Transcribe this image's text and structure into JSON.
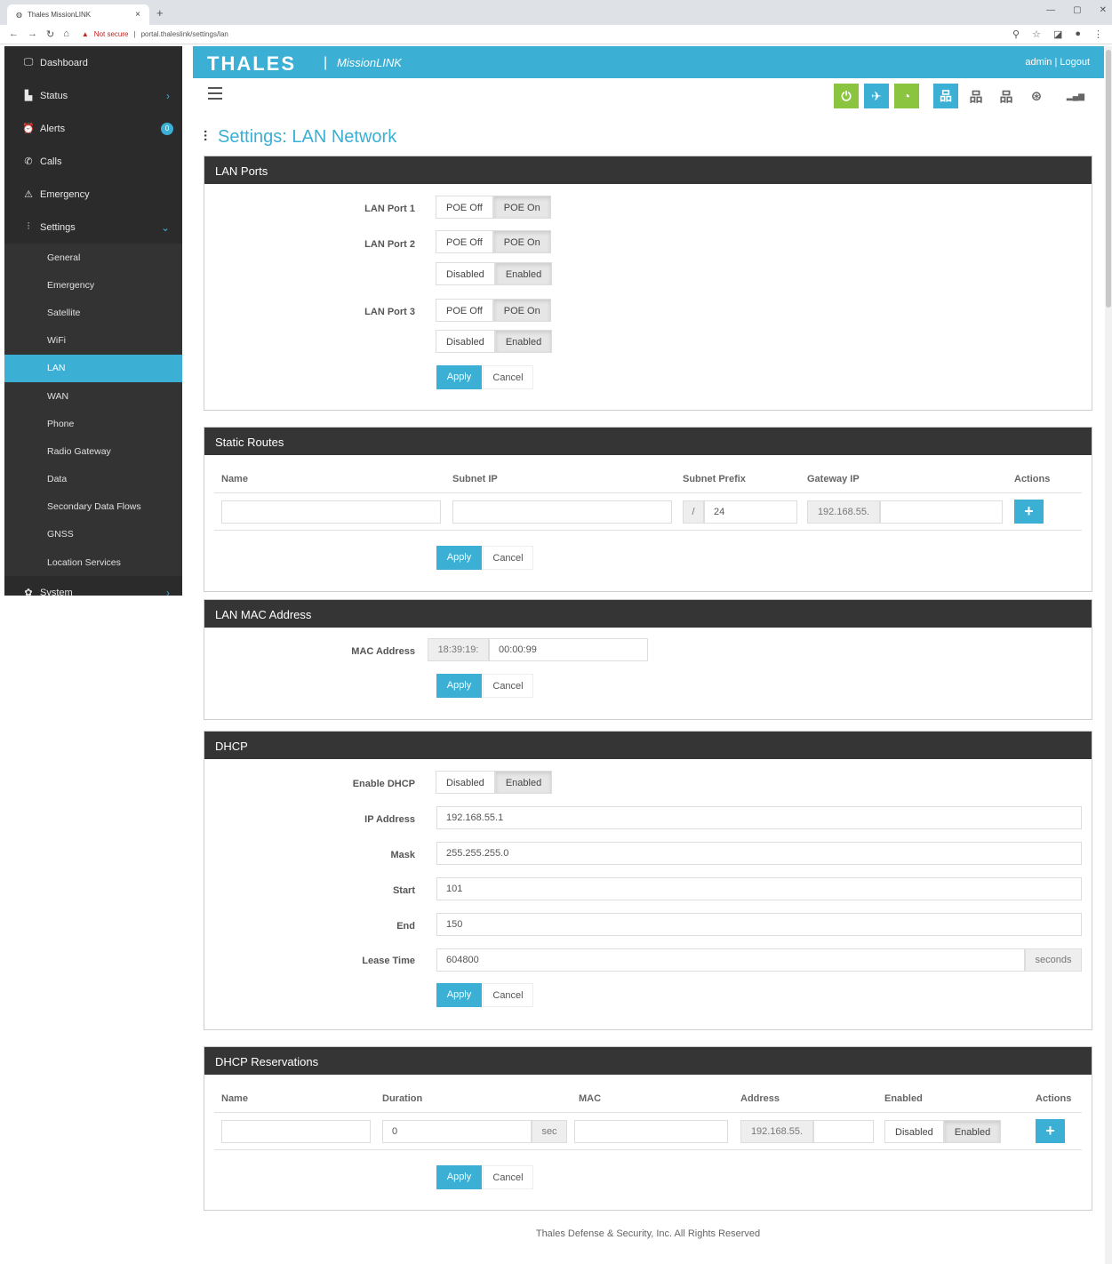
{
  "browser": {
    "tab_title": "Thales MissionLINK",
    "tab_close": "×",
    "new_tab": "+",
    "security_label": "Not secure",
    "url": "portal.thaleslink/settings/lan"
  },
  "sidebar": {
    "items": [
      {
        "label": "Dashboard",
        "icon": "monitor-icon",
        "glyph": "🖵"
      },
      {
        "label": "Status",
        "icon": "chart-icon",
        "glyph": "▙"
      },
      {
        "label": "Alerts",
        "icon": "alarm-icon",
        "glyph": "⏰",
        "badge": "0"
      },
      {
        "label": "Calls",
        "icon": "phone-icon",
        "glyph": "✆"
      },
      {
        "label": "Emergency",
        "icon": "warning-icon",
        "glyph": "⚠"
      },
      {
        "label": "Settings",
        "icon": "sliders-icon",
        "glyph": "⫶"
      }
    ],
    "sub_items": [
      "General",
      "Emergency",
      "Satellite",
      "WiFi",
      "LAN",
      "WAN",
      "Phone",
      "Radio Gateway",
      "Data",
      "Secondary Data Flows",
      "GNSS",
      "Location Services"
    ],
    "active_sub": "LAN",
    "system_label": "System"
  },
  "header": {
    "brand": "THALES",
    "separator": "|",
    "product": "MissionLINK",
    "user_text": "admin | Logout"
  },
  "status_icons": [
    {
      "name": "power-icon",
      "glyph": "⏻",
      "style": "green"
    },
    {
      "name": "antenna-icon",
      "glyph": "✈",
      "style": "blue"
    },
    {
      "name": "wifi-icon",
      "glyph": "◔",
      "style": "green"
    },
    {
      "name": "lan-network-icon",
      "glyph": "品",
      "style": "blue"
    },
    {
      "name": "network-icon",
      "glyph": "品",
      "style": "plain"
    },
    {
      "name": "network-alt-icon",
      "glyph": "品",
      "style": "plain"
    },
    {
      "name": "globe-icon",
      "glyph": "⊛",
      "style": "plain"
    },
    {
      "name": "signal-icon",
      "glyph": "▂▄▆",
      "style": "plain"
    }
  ],
  "page": {
    "title": "Settings: LAN Network",
    "footer": "Thales Defense & Security, Inc. All Rights Reserved"
  },
  "lan_ports": {
    "title": "LAN Ports",
    "port1_label": "LAN Port 1",
    "port2_label": "LAN Port 2",
    "port3_label": "LAN Port 3",
    "poe_off": "POE Off",
    "poe_on": "POE On",
    "disabled": "Disabled",
    "enabled": "Enabled",
    "apply": "Apply",
    "cancel": "Cancel"
  },
  "static_routes": {
    "title": "Static Routes",
    "columns": [
      "Name",
      "Subnet IP",
      "Subnet Prefix",
      "Gateway IP",
      "Actions"
    ],
    "prefix_addon": "/",
    "prefix_value": "24",
    "gateway_prefix": "192.168.55.",
    "add": "+",
    "apply": "Apply",
    "cancel": "Cancel"
  },
  "mac": {
    "title": "LAN MAC Address",
    "label": "MAC Address",
    "prefix": "18:39:19:",
    "suffix": "00:00:99",
    "apply": "Apply",
    "cancel": "Cancel"
  },
  "dhcp": {
    "title": "DHCP",
    "enable_label": "Enable DHCP",
    "disabled": "Disabled",
    "enabled": "Enabled",
    "ip_label": "IP Address",
    "ip_value": "192.168.55.1",
    "mask_label": "Mask",
    "mask_value": "255.255.255.0",
    "start_label": "Start",
    "start_value": "101",
    "end_label": "End",
    "end_value": "150",
    "lease_label": "Lease Time",
    "lease_value": "604800",
    "lease_unit": "seconds",
    "apply": "Apply",
    "cancel": "Cancel"
  },
  "reservations": {
    "title": "DHCP Reservations",
    "columns": [
      "Name",
      "Duration",
      "MAC",
      "Address",
      "Enabled",
      "Actions"
    ],
    "duration_value": "0",
    "duration_unit": "sec",
    "address_prefix": "192.168.55.",
    "disabled": "Disabled",
    "enabled": "Enabled",
    "add": "+",
    "apply": "Apply",
    "cancel": "Cancel"
  }
}
